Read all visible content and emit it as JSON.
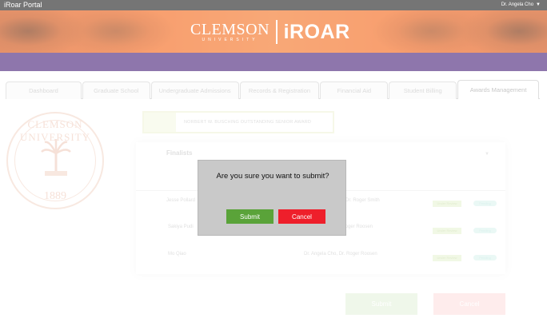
{
  "topbar": {
    "title": "iRoar Portal",
    "user": "Dr. Angela Cho"
  },
  "brand": {
    "clemson": "CLEMSON",
    "university": "UNIVERSITY",
    "app": "iROAR"
  },
  "tabs": [
    {
      "label": "Dashboard"
    },
    {
      "label": "Graduate School"
    },
    {
      "label": "Undergraduate Admissions"
    },
    {
      "label": "Records & Registration"
    },
    {
      "label": "Financial Aid"
    },
    {
      "label": "Student Billing"
    },
    {
      "label": "Awards Management"
    }
  ],
  "seal": {
    "top": "CLEMSON UNIVERSITY",
    "year": "1889"
  },
  "award": {
    "name": "NORBERT W. BUSCHING OUTSTANDING SENIOR AWARD"
  },
  "finalists": {
    "title": "Finalists",
    "rows": [
      {
        "name": "Jesse Pollard",
        "nominators": "Dr. Roger Smith",
        "status": "Under Review",
        "badge": "Pending"
      },
      {
        "name": "Sakiya Pudi",
        "nominators": "Dr. Roger Roosen",
        "status": "Under Review",
        "badge": "Pending"
      },
      {
        "name": "Mo Qiao",
        "nominators": "Dr. Angela Cho, Dr. Roger Roosen",
        "status": "Under Review",
        "badge": "Pending"
      }
    ]
  },
  "page_actions": {
    "submit": "Submit",
    "cancel": "Cancel"
  },
  "modal": {
    "message": "Are you sure you want to submit?",
    "confirm": "Submit",
    "cancel": "Cancel"
  },
  "colors": {
    "orange": "#f46a21",
    "purple": "#522d80",
    "confirm": "#5aa339",
    "cancel": "#ee1f2b"
  }
}
